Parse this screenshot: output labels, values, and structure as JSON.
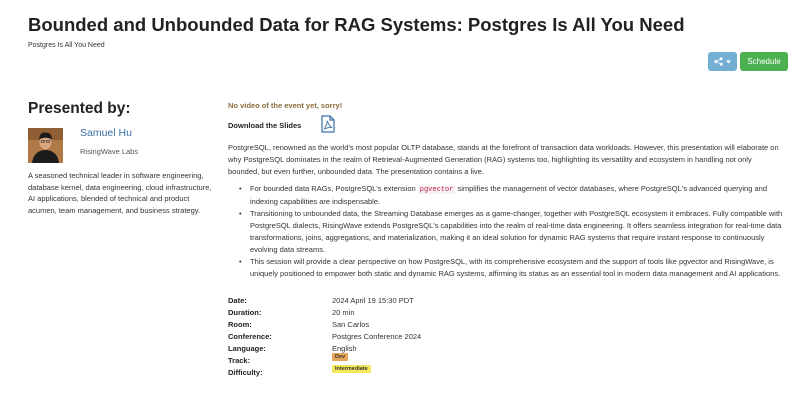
{
  "page": {
    "title": "Bounded and Unbounded Data for RAG Systems: Postgres Is All You Need",
    "subtitle": "Postgres Is All You Need"
  },
  "actions": {
    "share_icon": "share-icon",
    "schedule_label": "Schedule"
  },
  "presenter": {
    "heading": "Presented by:",
    "name": "Samuel Hu",
    "company": "RisingWave Labs",
    "bio": "A seasoned technical leader in software engineering, database kernel, data engineering, cloud infrastructure, AI applications, blended of technical and product acumen, team management, and business strategy."
  },
  "event": {
    "no_video": "No video of the event yet, sorry!",
    "download_label": "Download the Slides",
    "download_icon": "pdf-icon",
    "description": "PostgreSQL, renowned as the world's most popular OLTP database, stands at the forefront of transaction data workloads. However, this presentation will elaborate on why PostgreSQL dominates in the realm of Retrieval-Augmented Generation (RAG) systems too, highlighting its versatility and ecosystem in handling not only bounded, but even further, unbounded data. The presentation contains a live.",
    "bullet1_before": "For bounded data RAGs, PostgreSQL's extension ",
    "bullet1_code": "pgvector",
    "bullet1_after": " simplifies the management of vector databases, where PostgreSQL's advanced querying and indexing capabilities are indispensable.",
    "bullet2": "Transitioning to unbounded data, the Streaming Database emerges as a game-changer, together with PostgreSQL ecosystem it embraces. Fully compatible with PostgreSQL dialects, RisingWave extends PostgreSQL's capabilities into the realm of real-time data engineering. It offers seamless integration for real-time data transformations, joins, aggregations, and materialization, making it an ideal solution for dynamic RAG systems that require instant response to continuously evolving data streams.",
    "bullet3": "This session will provide a clear perspective on how PostgreSQL, with its comprehensive ecosystem and the support of tools like pgvector and RisingWave, is uniquely positioned to empower both static and dynamic RAG systems, affirming its status as an essential tool in modern data management and AI applications."
  },
  "details": {
    "date_label": "Date:",
    "date_value": "2024 April 19 15:30 PDT",
    "duration_label": "Duration:",
    "duration_value": "20 min",
    "room_label": "Room:",
    "room_value": "San Carlos",
    "conference_label": "Conference:",
    "conference_value": "Postgres Conference 2024",
    "language_label": "Language:",
    "language_value": "English",
    "track_label": "Track:",
    "track_value": "Dev",
    "difficulty_label": "Difficulty:",
    "difficulty_value": "Intermediate"
  },
  "colors": {
    "speaker_link": "#3a6fa5",
    "share_button": "#72afd2",
    "schedule_button": "#4caf50",
    "notice_text": "#8a6d3b",
    "track_badge": "#e8a55a",
    "difficulty_badge": "#f5e85a"
  }
}
